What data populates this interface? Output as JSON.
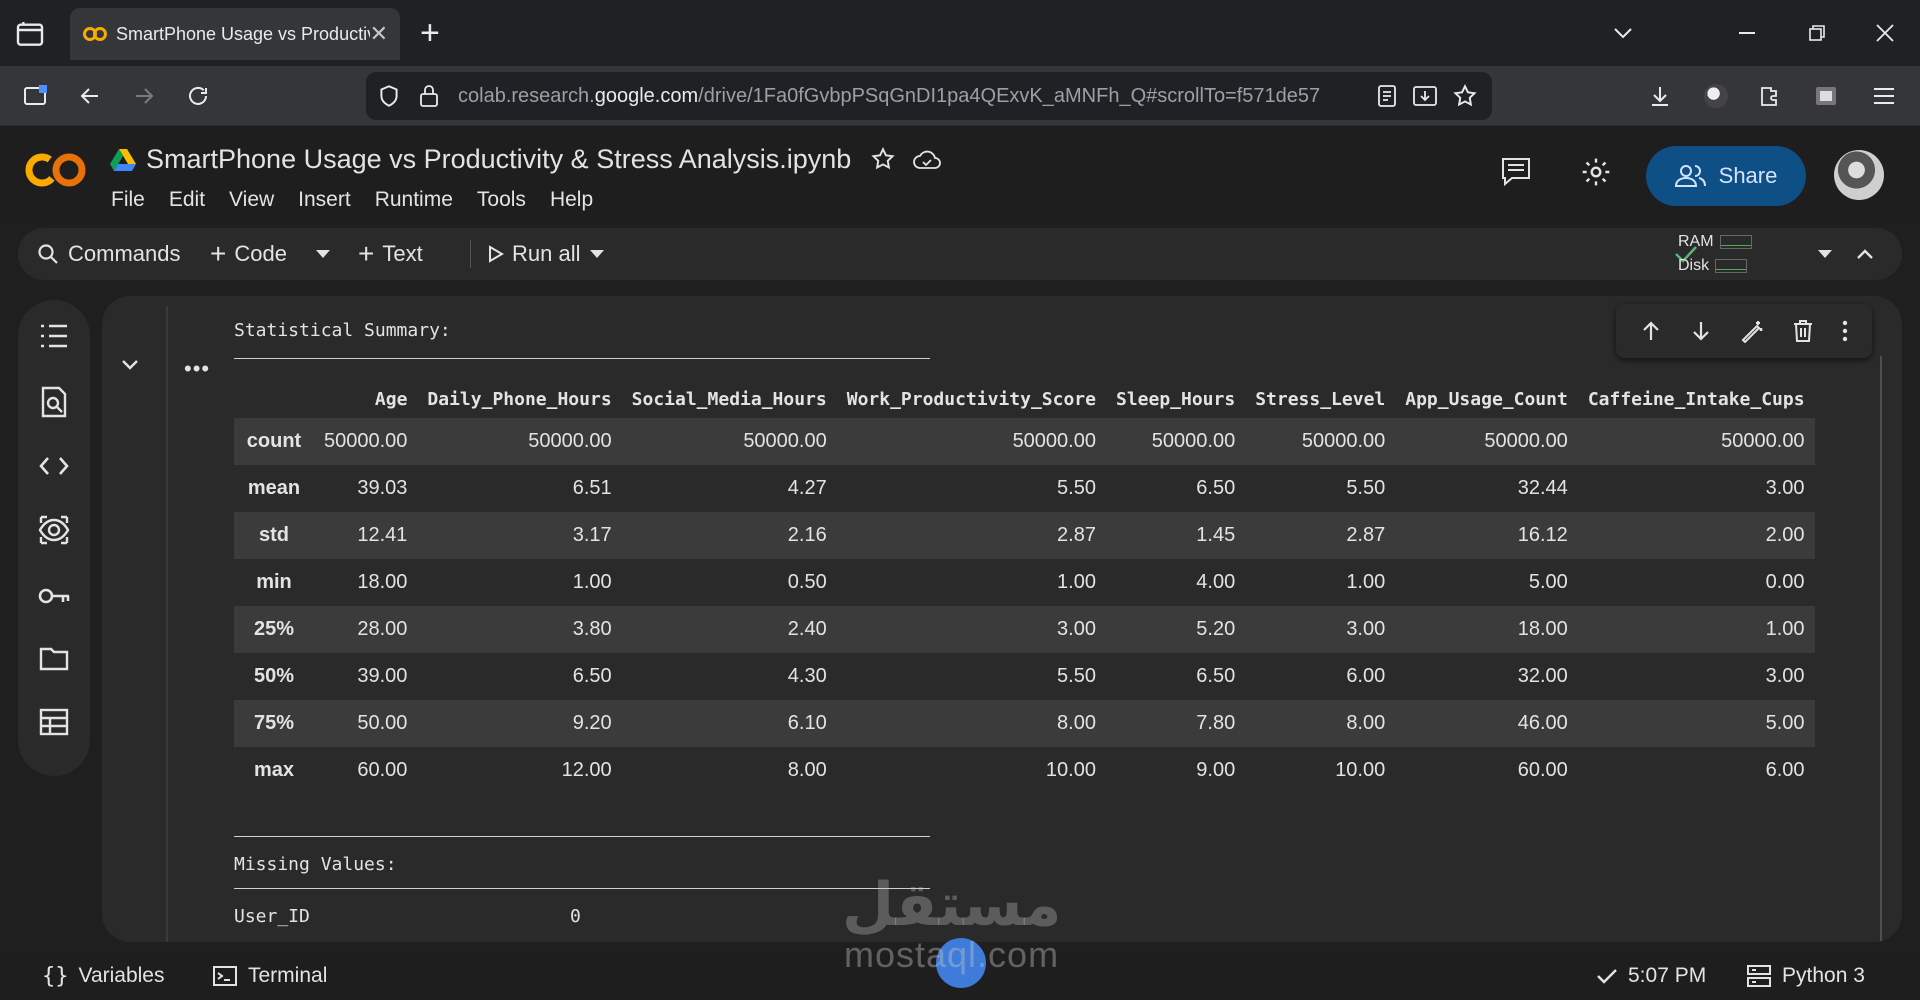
{
  "browser": {
    "tab_title": "SmartPhone Usage vs Productivity & Stress Analysis.ipynb",
    "tab_title_visible": "SmartPhone Usage vs Productiv",
    "url_prefix": "colab.research.",
    "url_domain": "google.com",
    "url_path": "/drive/1Fa0fGvbpPSqGnDI1pa4QExvK_aMNFh_Q#scrollTo=f571de57"
  },
  "header": {
    "logo_text": "CO",
    "notebook_title": "SmartPhone Usage vs Productivity & Stress Analysis.ipynb",
    "menu": [
      "File",
      "Edit",
      "View",
      "Insert",
      "Runtime",
      "Tools",
      "Help"
    ],
    "share_label": "Share"
  },
  "toolbar": {
    "commands_label": "Commands",
    "code_label": "Code",
    "text_label": "Text",
    "run_all_label": "Run all",
    "ram_label": "RAM",
    "disk_label": "Disk"
  },
  "output": {
    "summary_heading": "Statistical Summary:",
    "missing_heading": "Missing Values:",
    "missing_rows": [
      {
        "column": "User_ID",
        "value": "0"
      }
    ]
  },
  "table": {
    "columns": [
      "Age",
      "Daily_Phone_Hours",
      "Social_Media_Hours",
      "Work_Productivity_Score",
      "Sleep_Hours",
      "Stress_Level",
      "App_Usage_Count",
      "Caffeine_Intake_Cups"
    ],
    "rows": [
      {
        "label": "count",
        "values": [
          "50000.00",
          "50000.00",
          "50000.00",
          "50000.00",
          "50000.00",
          "50000.00",
          "50000.00",
          "50000.00"
        ]
      },
      {
        "label": "mean",
        "values": [
          "39.03",
          "6.51",
          "4.27",
          "5.50",
          "6.50",
          "5.50",
          "32.44",
          "3.00"
        ]
      },
      {
        "label": "std",
        "values": [
          "12.41",
          "3.17",
          "2.16",
          "2.87",
          "1.45",
          "2.87",
          "16.12",
          "2.00"
        ]
      },
      {
        "label": "min",
        "values": [
          "18.00",
          "1.00",
          "0.50",
          "1.00",
          "4.00",
          "1.00",
          "5.00",
          "0.00"
        ]
      },
      {
        "label": "25%",
        "values": [
          "28.00",
          "3.80",
          "2.40",
          "3.00",
          "5.20",
          "3.00",
          "18.00",
          "1.00"
        ]
      },
      {
        "label": "50%",
        "values": [
          "39.00",
          "6.50",
          "4.30",
          "5.50",
          "6.50",
          "6.00",
          "32.00",
          "3.00"
        ]
      },
      {
        "label": "75%",
        "values": [
          "50.00",
          "9.20",
          "6.10",
          "8.00",
          "7.80",
          "8.00",
          "46.00",
          "5.00"
        ]
      },
      {
        "label": "max",
        "values": [
          "60.00",
          "12.00",
          "8.00",
          "10.00",
          "9.00",
          "10.00",
          "60.00",
          "6.00"
        ]
      }
    ]
  },
  "statusbar": {
    "variables_label": "Variables",
    "terminal_label": "Terminal",
    "time": "5:07 PM",
    "runtime_label": "Python 3"
  },
  "watermark": {
    "arabic": "مستقل",
    "latin": "mostaql.com"
  },
  "colors": {
    "accent_orange": "#f9ab00",
    "share_bg": "#0e4f86",
    "status_green": "#5bb974"
  }
}
